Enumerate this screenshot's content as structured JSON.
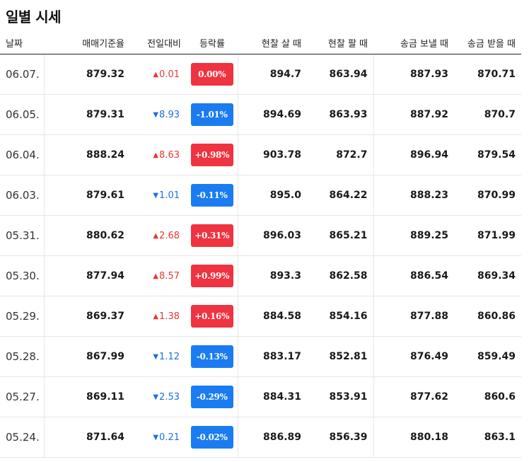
{
  "title": "일별 시세",
  "headers": {
    "date": "날짜",
    "base_rate": "매매기준율",
    "change": "전일대비",
    "change_rate": "등락률",
    "cash_buy": "현찰 살 때",
    "cash_sell": "현찰 팔 때",
    "transfer_send": "송금 보낼 때",
    "transfer_receive": "송금 받을 때"
  },
  "colors": {
    "up": "#ef3340",
    "down": "#1a7cf0"
  },
  "icons": {
    "up": "triangle-up-icon",
    "down": "triangle-down-icon"
  },
  "rows": [
    {
      "date": "06.07.",
      "base": "879.32",
      "dir": "up",
      "change": "0.01",
      "rate": "0.00%",
      "cash_buy": "894.7",
      "cash_sell": "863.94",
      "send": "887.93",
      "receive": "870.71"
    },
    {
      "date": "06.05.",
      "base": "879.31",
      "dir": "down",
      "change": "8.93",
      "rate": "-1.01%",
      "cash_buy": "894.69",
      "cash_sell": "863.93",
      "send": "887.92",
      "receive": "870.7"
    },
    {
      "date": "06.04.",
      "base": "888.24",
      "dir": "up",
      "change": "8.63",
      "rate": "+0.98%",
      "cash_buy": "903.78",
      "cash_sell": "872.7",
      "send": "896.94",
      "receive": "879.54"
    },
    {
      "date": "06.03.",
      "base": "879.61",
      "dir": "down",
      "change": "1.01",
      "rate": "-0.11%",
      "cash_buy": "895.0",
      "cash_sell": "864.22",
      "send": "888.23",
      "receive": "870.99"
    },
    {
      "date": "05.31.",
      "base": "880.62",
      "dir": "up",
      "change": "2.68",
      "rate": "+0.31%",
      "cash_buy": "896.03",
      "cash_sell": "865.21",
      "send": "889.25",
      "receive": "871.99"
    },
    {
      "date": "05.30.",
      "base": "877.94",
      "dir": "up",
      "change": "8.57",
      "rate": "+0.99%",
      "cash_buy": "893.3",
      "cash_sell": "862.58",
      "send": "886.54",
      "receive": "869.34"
    },
    {
      "date": "05.29.",
      "base": "869.37",
      "dir": "up",
      "change": "1.38",
      "rate": "+0.16%",
      "cash_buy": "884.58",
      "cash_sell": "854.16",
      "send": "877.88",
      "receive": "860.86"
    },
    {
      "date": "05.28.",
      "base": "867.99",
      "dir": "down",
      "change": "1.12",
      "rate": "-0.13%",
      "cash_buy": "883.17",
      "cash_sell": "852.81",
      "send": "876.49",
      "receive": "859.49"
    },
    {
      "date": "05.27.",
      "base": "869.11",
      "dir": "down",
      "change": "2.53",
      "rate": "-0.29%",
      "cash_buy": "884.31",
      "cash_sell": "853.91",
      "send": "877.62",
      "receive": "860.6"
    },
    {
      "date": "05.24.",
      "base": "871.64",
      "dir": "down",
      "change": "0.21",
      "rate": "-0.02%",
      "cash_buy": "886.89",
      "cash_sell": "856.39",
      "send": "880.18",
      "receive": "863.1"
    }
  ]
}
